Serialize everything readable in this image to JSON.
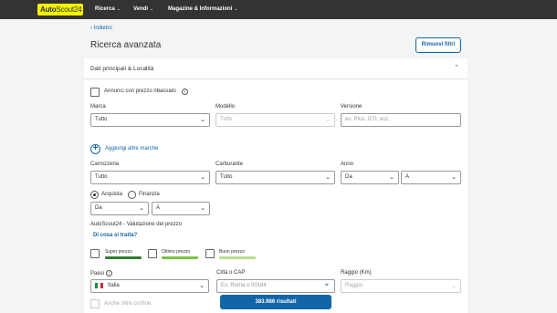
{
  "header": {
    "logo_main": "Auto",
    "logo_rest": "Scout24",
    "nav": [
      {
        "label": "Ricerca",
        "caret": "⌄"
      },
      {
        "label": "Vendi",
        "caret": "⌄"
      },
      {
        "label": "Magazine & Informazioni",
        "caret": "⌄"
      }
    ]
  },
  "page": {
    "back_label": "Indietro",
    "title": "Ricerca avanzata",
    "reset_label": "Rimuovi filtri"
  },
  "section": {
    "title": "Dati principali & Località",
    "discounted_label": "Annunci con prezzo ribassato"
  },
  "vehicle": {
    "make_label": "Marca",
    "make_value": "Tutto",
    "model_label": "Modello",
    "model_value": "Tutto",
    "version_label": "Versione",
    "version_placeholder": "es. Plus, GTI, ecc.",
    "add_makes_label": "Aggiungi altre marche"
  },
  "specs": {
    "body_label": "Carrozzeria",
    "body_value": "Tutto",
    "fuel_label": "Carburante",
    "fuel_value": "Tutto",
    "year_label": "Anno",
    "year_from": "Da",
    "year_to": "A"
  },
  "price": {
    "buy_label": "Acquista",
    "finance_label": "Finanzia",
    "from": "Da",
    "to": "A"
  },
  "evaluation": {
    "title": "AutoScout24 - Valutazione del prezzo",
    "link": "Di cosa si tratta?",
    "options": [
      {
        "label": "Super prezzo",
        "color": "#2e7d32"
      },
      {
        "label": "Ottimo prezzo",
        "color": "#7cc242"
      },
      {
        "label": "Buon prezzo",
        "color": "#b9de8c"
      }
    ]
  },
  "location": {
    "country_label": "Paesi",
    "country_value": "Italia",
    "city_label": "Città o CAP",
    "city_placeholder": "Es. Roma o 00184",
    "radius_label": "Raggio (Km)",
    "radius_value": "Raggio",
    "border_label": "Anche oltre confine"
  },
  "results_button": "383.986 risultati",
  "colors": {
    "accent": "#1166a8",
    "topbar": "#333333",
    "logo": "#f5f200",
    "flag": [
      "#009246",
      "#ffffff",
      "#ce2b37"
    ]
  }
}
